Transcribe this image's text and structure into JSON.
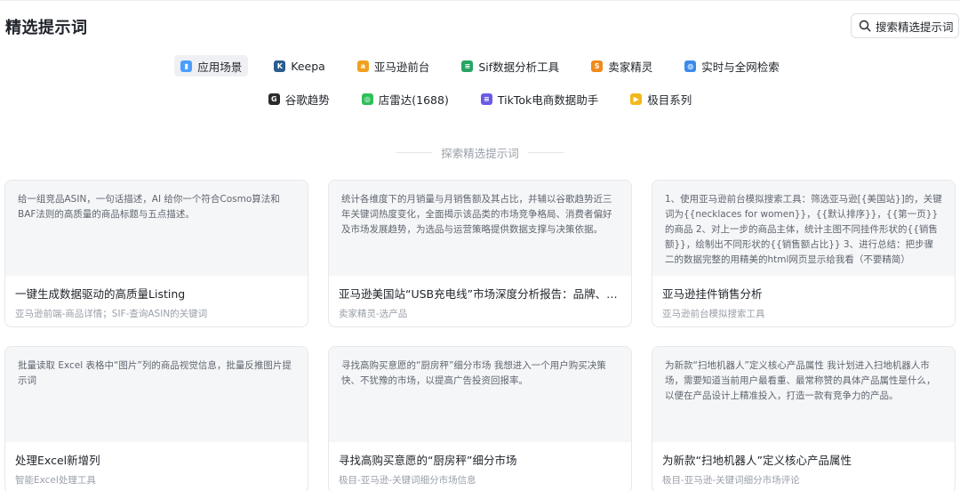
{
  "header": {
    "title": "精选提示词",
    "search_label": "搜索精选提示词"
  },
  "categories": [
    {
      "label": "应用场景",
      "icon": "app-scene-icon",
      "color": "#4a9eff",
      "glyph": "▮",
      "active": true
    },
    {
      "label": "Keepa",
      "icon": "keepa-icon",
      "color": "#2a5d8f",
      "glyph": "K",
      "active": false
    },
    {
      "label": "亚马逊前台",
      "icon": "amazon-icon",
      "color": "#f0a020",
      "glyph": "a",
      "active": false
    },
    {
      "label": "Sif数据分析工具",
      "icon": "sif-icon",
      "color": "#27a464",
      "glyph": "≡",
      "active": false
    },
    {
      "label": "卖家精灵",
      "icon": "seller-sprite-icon",
      "color": "#f08a1c",
      "glyph": "S",
      "active": false
    },
    {
      "label": "实时与全网检索",
      "icon": "globe-icon",
      "color": "#3b8bea",
      "glyph": "◍",
      "active": false
    },
    {
      "label": "谷歌趋势",
      "icon": "google-trends-icon",
      "color": "#2b2b2b",
      "glyph": "G",
      "active": false
    },
    {
      "label": "店雷达(1688)",
      "icon": "store-radar-icon",
      "color": "#2fbf5a",
      "glyph": "◎",
      "active": false
    },
    {
      "label": "TikTok电商数据助手",
      "icon": "tiktok-data-icon",
      "color": "#6a5be6",
      "glyph": "≡",
      "active": false
    },
    {
      "label": "极目系列",
      "icon": "jimu-series-icon",
      "color": "#f2b81c",
      "glyph": "▶",
      "active": false
    }
  ],
  "explore_label": "探索精选提示词",
  "cards": [
    {
      "preview": "给一组竞品ASIN，一句话描述，AI 给你一个符合Cosmo算法和BAF法则的高质量的商品标题与五点描述。",
      "title": "一键生成数据驱动的高质量Listing",
      "subtitle": "亚马逊前端-商品详情；SIF-查询ASIN的关键词"
    },
    {
      "preview": "统计各维度下的月销量与月销售额及其占比，并辅以谷歌趋势近三年关键词热度变化，全面揭示该品类的市场竞争格局、消费者偏好及市场发展趋势，为选品与运营策略提供数据支撑与决策依据。",
      "title": "亚马逊美国站“USB充电线”市场深度分析报告：品牌、价格、功能与市场趋势",
      "subtitle": "卖家精灵-选产品"
    },
    {
      "preview": "1、使用亚马逊前台模拟搜索工具：筛选亚马逊[{美国站}]的，关键词为{{necklaces for women}}，{{默认排序}}，{{第一页}}的商品 2、对上一步的商品主体，统计主图不同挂件形状的{{销售额}}，绘制出不同形状的{{销售额占比}} 3、进行总结：把步骤二的数据完整的用精美的html网页显示给我看（不要精简）",
      "title": "亚马逊挂件销售分析",
      "subtitle": "亚马逊前台模拟搜索工具"
    },
    {
      "preview": "批量读取 Excel 表格中“图片”列的商品视觉信息，批量反推图片提示词",
      "title": "处理Excel新增列",
      "subtitle": "智能Excel处理工具"
    },
    {
      "preview": "寻找高购买意愿的“厨房秤”细分市场 我想进入一个用户购买决策快、不犹豫的市场，以提高广告投资回报率。",
      "title": "寻找高购买意愿的“厨房秤”细分市场",
      "subtitle": "极目-亚马逊-关键词细分市场信息"
    },
    {
      "preview": "为新款“扫地机器人”定义核心产品属性 我计划进入扫地机器人市场，需要知道当前用户最看重、最常称赞的具体产品属性是什么，以便在产品设计上精准投入，打造一款有竞争力的产品。",
      "title": "为新款“扫地机器人”定义核心产品属性",
      "subtitle": "极目-亚马逊-关键词细分市场评论"
    }
  ]
}
